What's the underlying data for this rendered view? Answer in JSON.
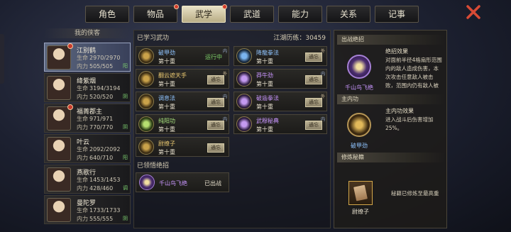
{
  "tabs": [
    {
      "label": "角色",
      "dot": false
    },
    {
      "label": "物品",
      "dot": true
    },
    {
      "label": "武学",
      "dot": true,
      "active": true
    },
    {
      "label": "武道",
      "dot": false
    },
    {
      "label": "能力",
      "dot": false
    },
    {
      "label": "关系",
      "dot": false
    },
    {
      "label": "记事",
      "dot": false
    }
  ],
  "char_panel_label": "我的侠客",
  "stat_labels": {
    "hp": "生命",
    "mp": "内力"
  },
  "characters": [
    {
      "name": "江别鹤",
      "hp": "2970/2970",
      "mp": "505/505",
      "side": "阳",
      "active": true,
      "badge": true
    },
    {
      "name": "绛紫烟",
      "hp": "3194/3194",
      "mp": "520/520",
      "side": "阴",
      "badge": false
    },
    {
      "name": "福菁郡主",
      "hp": "971/971",
      "mp": "770/770",
      "side": "阴",
      "badge": true
    },
    {
      "name": "叶云",
      "hp": "2092/2092",
      "mp": "640/710",
      "side": "阳",
      "badge": false
    },
    {
      "name": "燕歌行",
      "hp": "1453/1453",
      "mp": "428/460",
      "side": "调",
      "badge": false
    },
    {
      "name": "曼陀罗",
      "hp": "1733/1733",
      "mp": "555/555",
      "side": "阴",
      "badge": false
    }
  ],
  "middle": {
    "learned_title": "已学习武功",
    "score_label": "江湖历练：",
    "score_value": "30459",
    "insight_title": "已领悟绝招",
    "skills": [
      {
        "name": "破甲劲",
        "level": "第十重",
        "state": "运行中",
        "tag": "内",
        "color": "blue",
        "icon": "gold"
      },
      {
        "name": "降龍拳法",
        "level": "第十重",
        "state": "通忘",
        "tag": "外",
        "color": "blue",
        "icon": "blue"
      },
      {
        "name": "翻云遮天手",
        "level": "第十重",
        "state": "通忘",
        "tag": "外",
        "color": "gold",
        "icon": "gold"
      },
      {
        "name": "莽牛劲",
        "level": "第十重",
        "state": "通忘",
        "tag": "内",
        "color": "purple",
        "icon": "purple"
      },
      {
        "name": "调息法",
        "level": "第十重",
        "state": "通忘",
        "tag": "内",
        "color": "blue",
        "icon": "gold"
      },
      {
        "name": "破庙拳法",
        "level": "第十重",
        "state": "通忘",
        "tag": "外",
        "color": "purple",
        "icon": "purple"
      },
      {
        "name": "纯阳功",
        "level": "第十重",
        "state": "通忘",
        "tag": "内",
        "color": "green",
        "icon": "green"
      },
      {
        "name": "武穆秘典",
        "level": "第十重",
        "state": "通忘",
        "tag": "内",
        "color": "purple",
        "icon": "purple"
      },
      {
        "name": "尉缭子",
        "level": "第十重",
        "state": "通忘",
        "tag": "",
        "color": "gold",
        "icon": "gold"
      }
    ],
    "ultimate": {
      "name": "千山鸟飞绝",
      "state": "已出战"
    }
  },
  "right": {
    "battle_head": "出战绝招",
    "ult_effect_title": "绝招效果",
    "ult_effect_desc": "对面前半径4格扇形范围内的敌人造成伤害，本次攻击任意敌人被击败，范围内仍有敌人被",
    "ult_name": "千山鸟飞绝",
    "inner_head": "主内功",
    "inner_effect_title": "主内功效果",
    "inner_effect_desc": "进入战斗后伤害增加25%。",
    "inner_name": "破甲劲",
    "practice_head": "修炼秘籍",
    "practice_desc": "秘籍已修炼至最高重",
    "practice_name": "尉缭子"
  }
}
